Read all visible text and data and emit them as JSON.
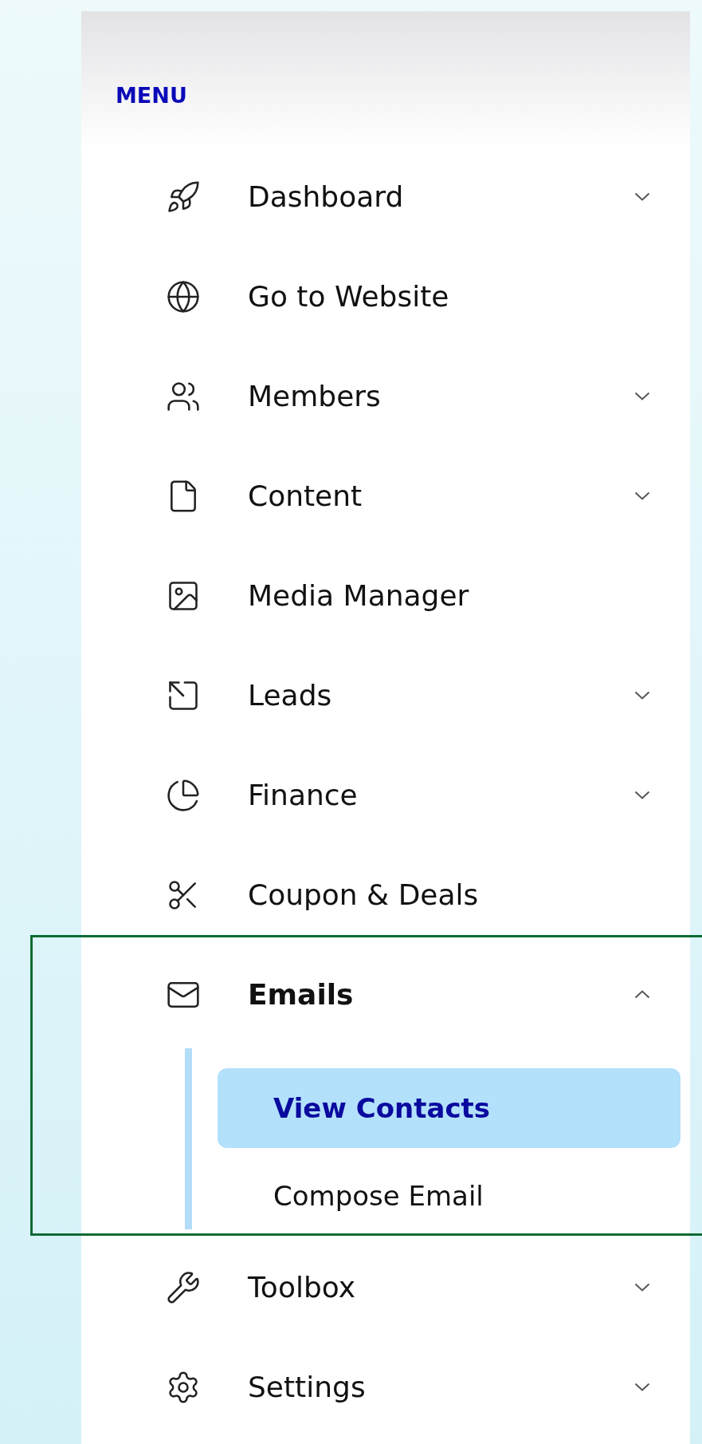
{
  "menu_title": "MENU",
  "items": [
    {
      "label": "Dashboard",
      "expanded": false
    },
    {
      "label": "Go to Website"
    },
    {
      "label": "Members",
      "expanded": false
    },
    {
      "label": "Content",
      "expanded": false
    },
    {
      "label": "Media Manager"
    },
    {
      "label": "Leads",
      "expanded": false
    },
    {
      "label": "Finance",
      "expanded": false
    },
    {
      "label": "Coupon & Deals"
    },
    {
      "label": "Emails",
      "expanded": true,
      "highlighted": true,
      "children": [
        {
          "label": "View Contacts",
          "selected": true
        },
        {
          "label": "Compose Email",
          "selected": false
        }
      ]
    },
    {
      "label": "Toolbox",
      "expanded": false
    },
    {
      "label": "Settings",
      "expanded": false
    }
  ]
}
